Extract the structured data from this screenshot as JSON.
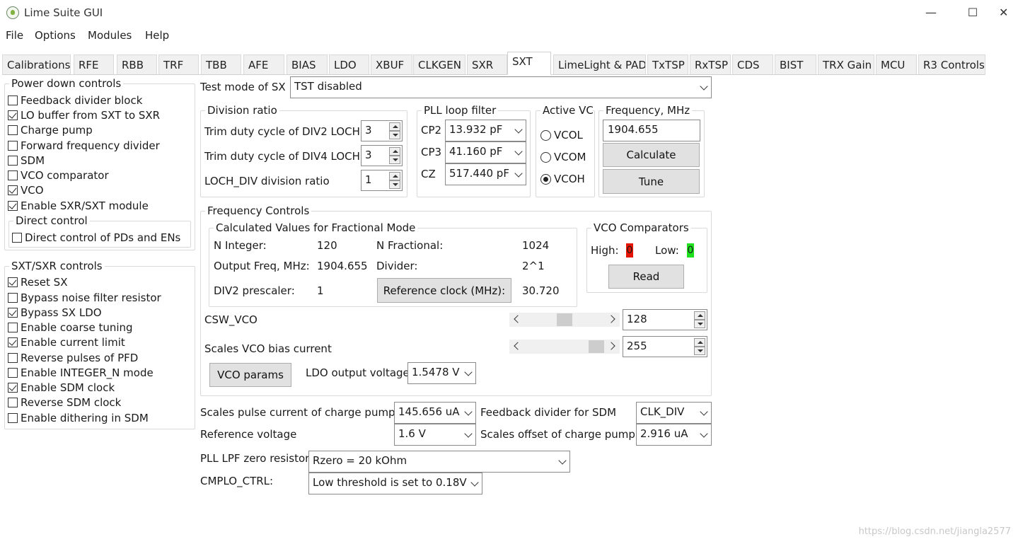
{
  "window": {
    "title": "Lime Suite GUI",
    "minimize": "—",
    "maximize": "☐",
    "close": "✕"
  },
  "menu": [
    "File",
    "Options",
    "Modules",
    "Help"
  ],
  "tabs": [
    "Calibrations",
    "RFE",
    "RBB",
    "TRF",
    "TBB",
    "AFE",
    "BIAS",
    "LDO",
    "XBUF",
    "CLKGEN",
    "SXR",
    "SXT",
    "LimeLight & PAD",
    "TxTSP",
    "RxTSP",
    "CDS",
    "BIST",
    "TRX Gain",
    "MCU",
    "R3 Controls"
  ],
  "active_tab": "SXT",
  "power_down": {
    "title": "Power down controls",
    "items": [
      {
        "label": "Feedback divider block",
        "checked": false
      },
      {
        "label": "LO buffer from SXT to SXR",
        "checked": true
      },
      {
        "label": "Charge pump",
        "checked": false
      },
      {
        "label": "Forward frequency divider",
        "checked": false
      },
      {
        "label": "SDM",
        "checked": false
      },
      {
        "label": "VCO comparator",
        "checked": false
      },
      {
        "label": "VCO",
        "checked": true
      },
      {
        "label": "Enable SXR/SXT module",
        "checked": true
      }
    ],
    "direct_control": {
      "title": "Direct control",
      "label": "Direct control of PDs and ENs",
      "checked": false
    }
  },
  "sxt_controls": {
    "title": "SXT/SXR controls",
    "items": [
      {
        "label": "Reset SX",
        "checked": true
      },
      {
        "label": "Bypass noise filter resistor",
        "checked": false
      },
      {
        "label": "Bypass SX LDO",
        "checked": true
      },
      {
        "label": "Enable coarse tuning",
        "checked": false
      },
      {
        "label": "Enable current limit",
        "checked": true
      },
      {
        "label": "Reverse pulses of PFD",
        "checked": false
      },
      {
        "label": "Enable INTEGER_N mode",
        "checked": false
      },
      {
        "label": "Enable SDM clock",
        "checked": true
      },
      {
        "label": "Reverse SDM clock",
        "checked": false
      },
      {
        "label": "Enable dithering in SDM",
        "checked": false
      }
    ]
  },
  "test_mode": {
    "label": "Test mode of SX",
    "value": "TST disabled"
  },
  "division_ratio": {
    "title": "Division ratio",
    "rows": [
      {
        "label": "Trim duty cycle of DIV2 LOCH",
        "value": "3"
      },
      {
        "label": "Trim duty cycle of DIV4 LOCH",
        "value": "3"
      },
      {
        "label": "LOCH_DIV division ratio",
        "value": "1"
      }
    ]
  },
  "pll_loop_filter": {
    "title": "PLL loop filter",
    "rows": [
      {
        "label": "CP2",
        "value": "13.932 pF"
      },
      {
        "label": "CP3",
        "value": "41.160 pF"
      },
      {
        "label": "CZ",
        "value": "517.440 pF"
      }
    ]
  },
  "active_vco": {
    "title": "Active VC(",
    "options": [
      {
        "label": "VCOL",
        "selected": false
      },
      {
        "label": "VCOM",
        "selected": false
      },
      {
        "label": "VCOH",
        "selected": true
      }
    ]
  },
  "frequency": {
    "title": "Frequency, MHz",
    "value": "1904.655",
    "calculate": "Calculate",
    "tune": "Tune"
  },
  "freq_controls": {
    "title": "Frequency Controls",
    "calc": {
      "title": "Calculated Values for Fractional Mode",
      "n_integer_label": "N Integer:",
      "n_integer": "120",
      "n_fractional_label": "N Fractional:",
      "n_fractional": "1024",
      "out_freq_label": "Output Freq, MHz:",
      "out_freq": "1904.655",
      "divider_label": "Divider:",
      "divider": "2^1",
      "div2_label": "DIV2 prescaler:",
      "div2": "1",
      "ref_clock_button": "Reference clock (MHz):",
      "ref_clock": "30.720"
    },
    "vco_comp": {
      "title": "VCO Comparators",
      "high_label": "High:",
      "high": "0",
      "low_label": "Low:",
      "low": "0",
      "read": "Read",
      "high_color": "#e51400",
      "low_color": "#1fe01f"
    },
    "csw_vco": {
      "label": "CSW_VCO",
      "value": "128",
      "fraction": 0.5
    },
    "vco_bias": {
      "label": "Scales VCO bias current",
      "value": "255",
      "fraction": 1.0
    },
    "vco_params": "VCO params",
    "ldo": {
      "label": "LDO output voltage",
      "value": "1.5478 V"
    }
  },
  "bottom": {
    "cp_pulse": {
      "label": "Scales pulse current of charge pump",
      "value": "145.656 uA"
    },
    "fb_div_sdm": {
      "label": "Feedback divider for SDM",
      "value": "CLK_DIV"
    },
    "ref_voltage": {
      "label": "Reference voltage",
      "value": "1.6 V"
    },
    "cp_offset": {
      "label": "Scales offset of charge pump",
      "value": "2.916 uA"
    },
    "lpf_zero": {
      "label": "PLL LPF zero resistor:",
      "value": "Rzero = 20 kOhm"
    },
    "cmplo": {
      "label": "CMPLO_CTRL:",
      "value": "Low threshold is set to 0.18V"
    }
  },
  "watermark": "https://blog.csdn.net/jiangla2577"
}
